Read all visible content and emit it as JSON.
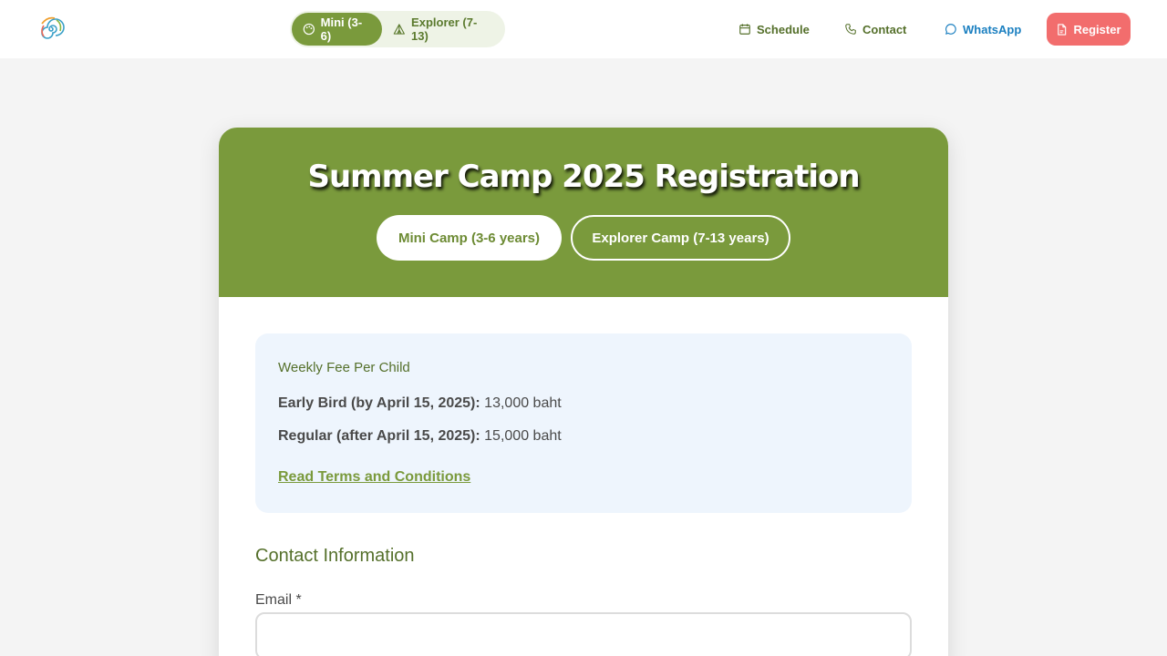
{
  "nav": {
    "logo_icon": "spiral-logo-icon",
    "age_toggle": [
      {
        "label": "Mini (3-6)",
        "icon": "palette-icon",
        "active": true
      },
      {
        "label": "Explorer (7-13)",
        "icon": "tent-icon",
        "active": false
      }
    ],
    "links": [
      {
        "label": "Schedule",
        "icon": "calendar-icon"
      },
      {
        "label": "Contact",
        "icon": "phone-icon"
      },
      {
        "label": "WhatsApp",
        "icon": "chat-bubble-icon"
      }
    ],
    "register_label": "Register",
    "register_icon": "document-icon"
  },
  "colors": {
    "brand_green": "#7a9a3c",
    "dark_green": "#55702b",
    "register_red": "#f26d6d",
    "whatsapp_blue": "#1a7fc0",
    "fee_box_bg": "#eef5fd"
  },
  "card": {
    "title": "Summer Camp 2025 Registration",
    "camp_options": [
      "Mini Camp (3-6 years)",
      "Explorer Camp (7-13 years)"
    ],
    "selected_camp": "Mini Camp (3-6 years)",
    "fees": {
      "heading": "Weekly Fee Per Child",
      "early_label": "Early Bird (by April 15, 2025):",
      "early_value": "13,000 baht",
      "regular_label": "Regular (after April 15, 2025):",
      "regular_value": "15,000 baht",
      "terms_link": "Read Terms and Conditions"
    },
    "contact_section_title": "Contact Information",
    "email_label": "Email *",
    "email_value": ""
  }
}
